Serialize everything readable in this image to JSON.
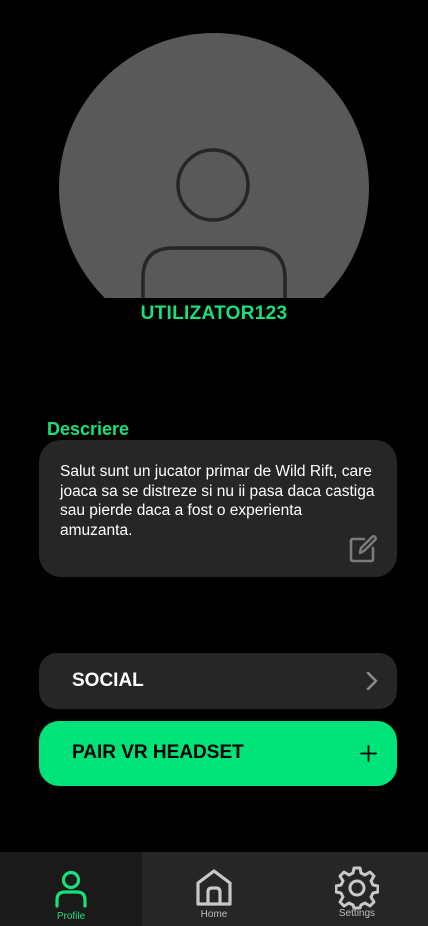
{
  "profile": {
    "username": "UTILIZATOR123",
    "avatar_icon": "user-silhouette-icon"
  },
  "description": {
    "label": "Descriere",
    "text": "Salut sunt un jucator primar de Wild Rift, care joaca sa se distreze si nu ii pasa daca castiga sau pierde daca a fost o experienta amuzanta.",
    "edit_icon": "edit-icon"
  },
  "actions": {
    "social_label": "SOCIAL",
    "social_icon": "chevron-right-icon",
    "pair_label": "PAIR VR HEADSET",
    "pair_icon": "plus-icon"
  },
  "nav": {
    "items": [
      {
        "label": "Profile",
        "icon": "person-icon",
        "active": true
      },
      {
        "label": "Home",
        "icon": "home-icon",
        "active": false
      },
      {
        "label": "Settings",
        "icon": "gear-icon",
        "active": false
      }
    ]
  },
  "colors": {
    "accent": "#00e27a",
    "background": "#000000",
    "card": "#262626",
    "avatar": "#595959"
  }
}
